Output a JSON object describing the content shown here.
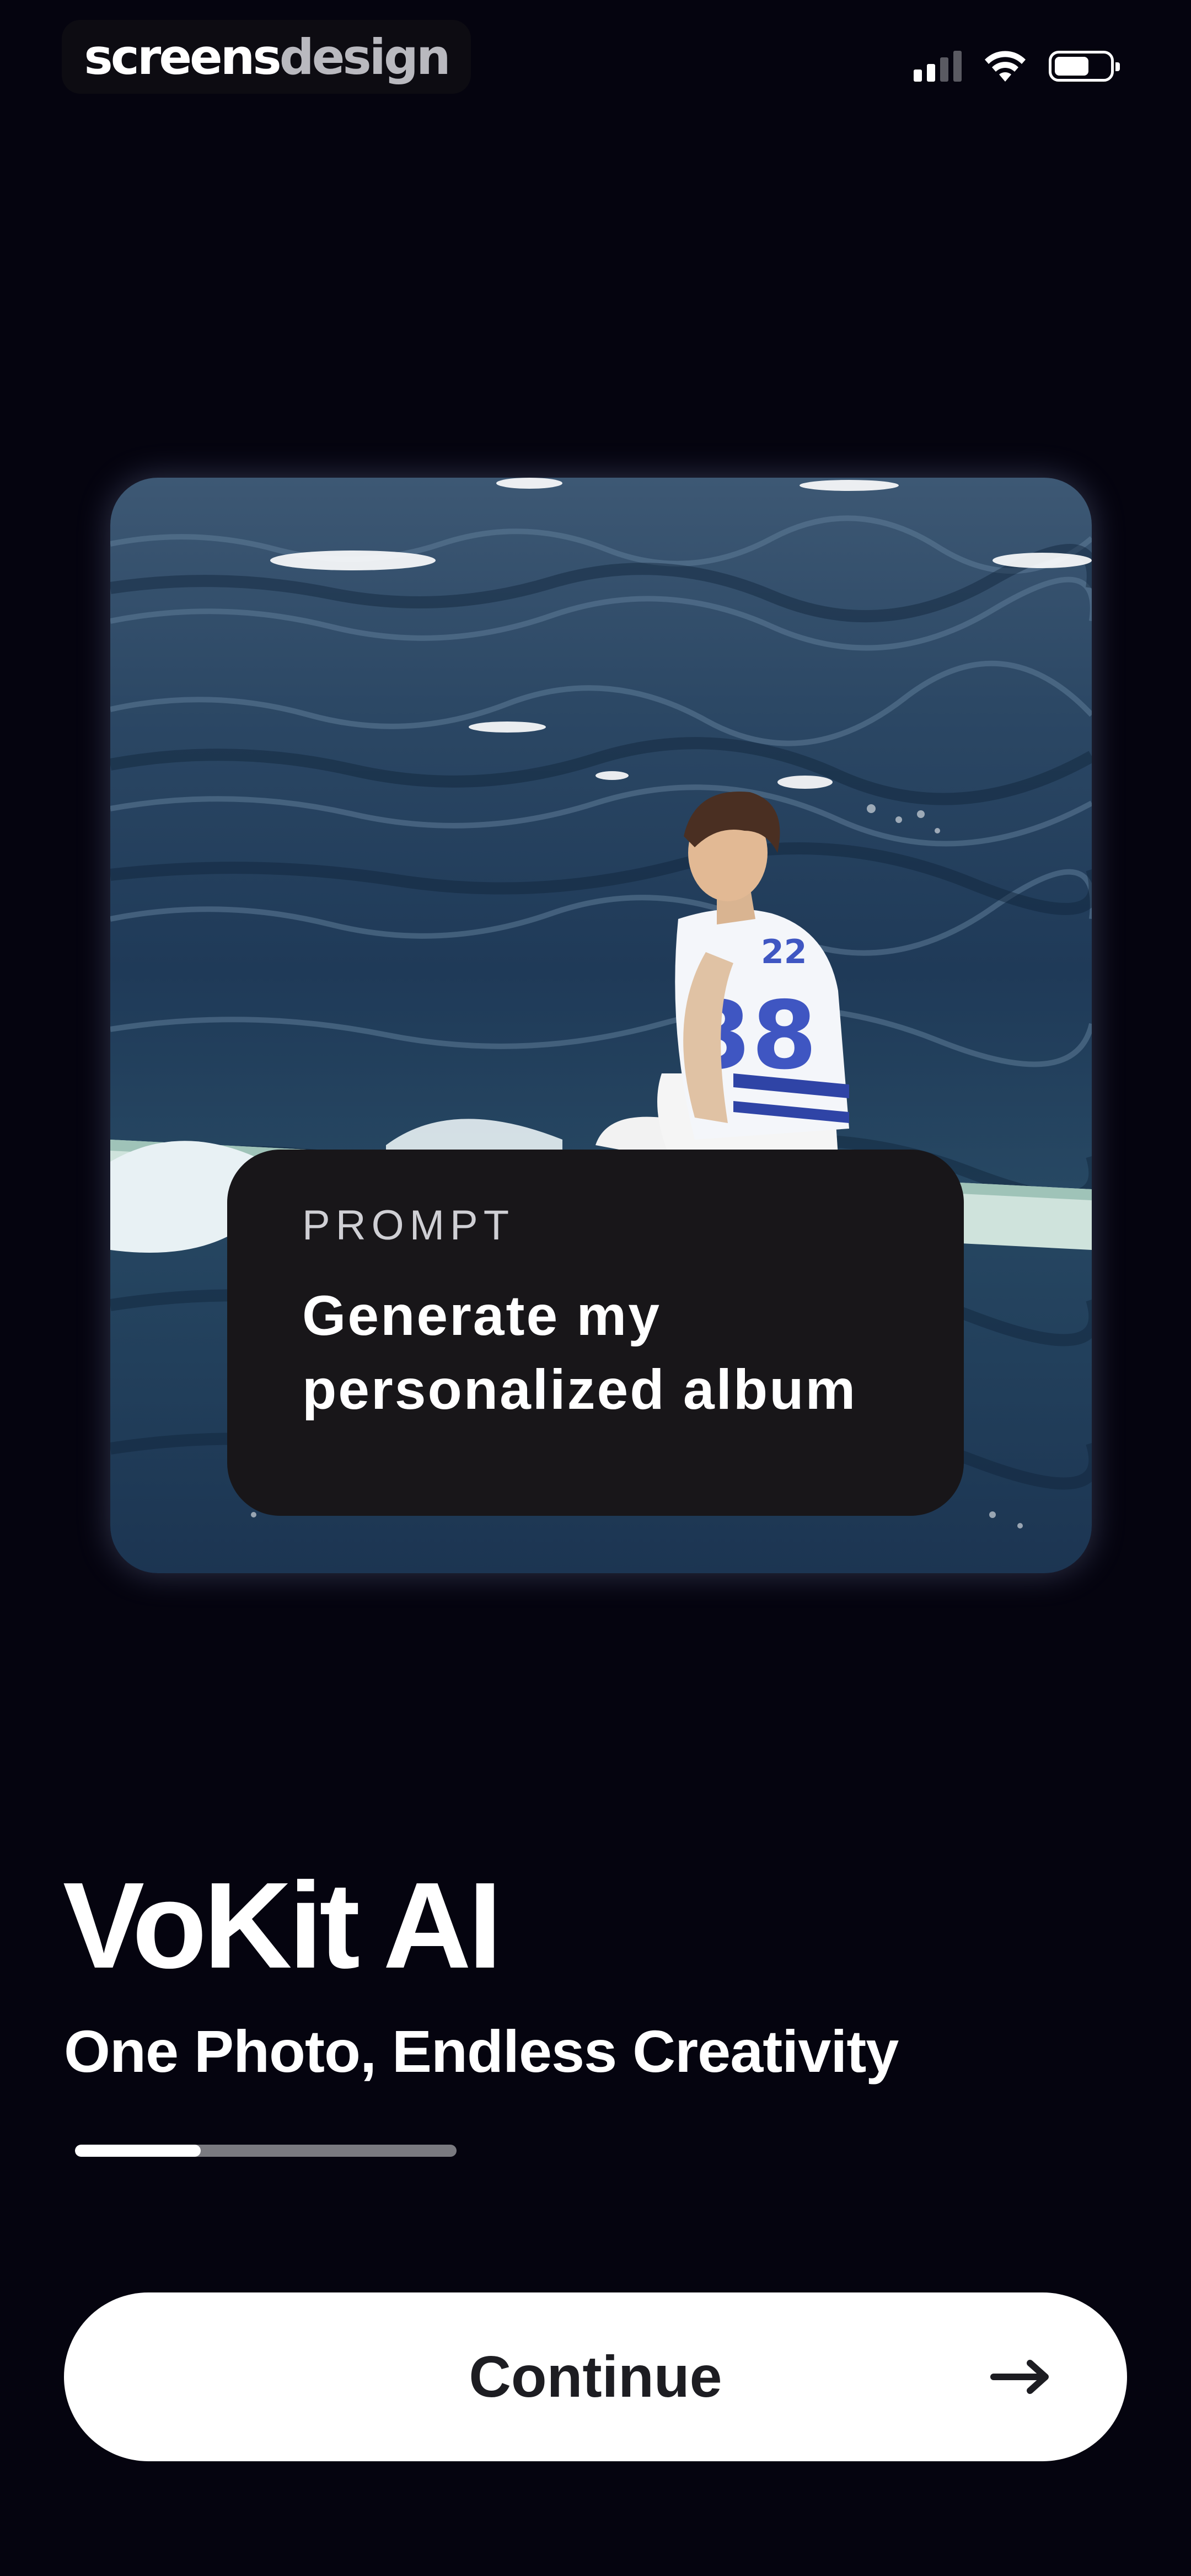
{
  "watermark": {
    "part_a": "screens",
    "part_b": "design"
  },
  "status_bar": {
    "signal_icon": "cellular-signal-icon",
    "wifi_icon": "wifi-icon",
    "battery_icon": "battery-icon",
    "battery_level": 0.64
  },
  "hero": {
    "image_alt": "man in a white #38 jersey sitting on a surfboard in ocean waves",
    "prompt_label": "PROMPT",
    "prompt_text": "Generate my personalized album"
  },
  "app": {
    "title": "VoKit AI",
    "subtitle": "One Photo, Endless Creativity"
  },
  "onboarding_progress": {
    "value": 0.33
  },
  "continue_button": {
    "label": "Continue",
    "icon": "arrow-right-icon"
  }
}
